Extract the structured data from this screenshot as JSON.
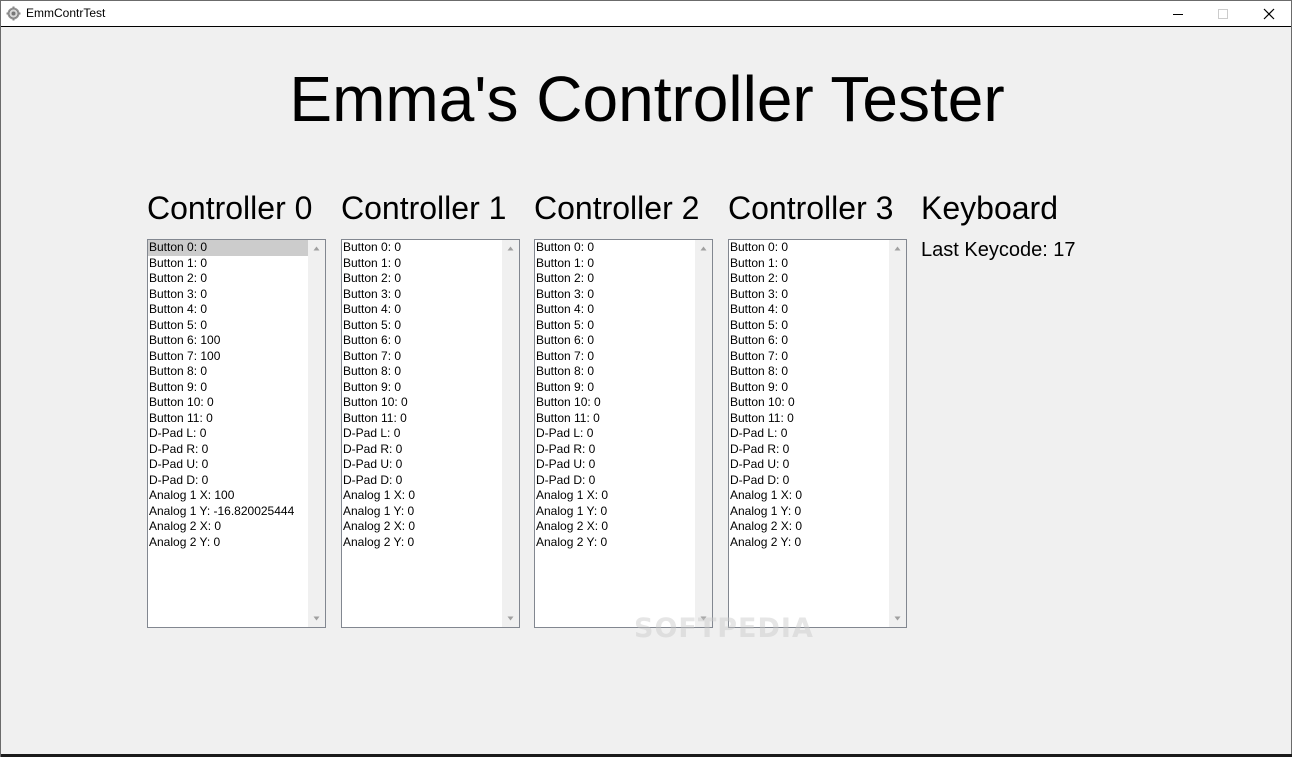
{
  "window": {
    "title": "EmmContrTest",
    "icon": "gear-icon"
  },
  "main_title": "Emma's Controller Tester",
  "controllers": [
    {
      "heading": "Controller 0",
      "selected_index": 0,
      "items": [
        "Button 0: 0",
        "Button 1: 0",
        "Button 2: 0",
        "Button 3: 0",
        "Button 4: 0",
        "Button 5: 0",
        "Button 6: 100",
        "Button 7: 100",
        "Button 8: 0",
        "Button 9: 0",
        "Button 10: 0",
        "Button 11: 0",
        "D-Pad L: 0",
        "D-Pad R: 0",
        "D-Pad U: 0",
        "D-Pad D: 0",
        "Analog 1 X: 100",
        "Analog 1 Y: -16.820025444",
        "Analog 2 X: 0",
        "Analog 2 Y: 0"
      ]
    },
    {
      "heading": "Controller 1",
      "selected_index": -1,
      "items": [
        "Button 0: 0",
        "Button 1: 0",
        "Button 2: 0",
        "Button 3: 0",
        "Button 4: 0",
        "Button 5: 0",
        "Button 6: 0",
        "Button 7: 0",
        "Button 8: 0",
        "Button 9: 0",
        "Button 10: 0",
        "Button 11: 0",
        "D-Pad L: 0",
        "D-Pad R: 0",
        "D-Pad U: 0",
        "D-Pad D: 0",
        "Analog 1 X: 0",
        "Analog 1 Y: 0",
        "Analog 2 X: 0",
        "Analog 2 Y: 0"
      ]
    },
    {
      "heading": "Controller 2",
      "selected_index": -1,
      "items": [
        "Button 0: 0",
        "Button 1: 0",
        "Button 2: 0",
        "Button 3: 0",
        "Button 4: 0",
        "Button 5: 0",
        "Button 6: 0",
        "Button 7: 0",
        "Button 8: 0",
        "Button 9: 0",
        "Button 10: 0",
        "Button 11: 0",
        "D-Pad L: 0",
        "D-Pad R: 0",
        "D-Pad U: 0",
        "D-Pad D: 0",
        "Analog 1 X: 0",
        "Analog 1 Y: 0",
        "Analog 2 X: 0",
        "Analog 2 Y: 0"
      ]
    },
    {
      "heading": "Controller 3",
      "selected_index": -1,
      "items": [
        "Button 0: 0",
        "Button 1: 0",
        "Button 2: 0",
        "Button 3: 0",
        "Button 4: 0",
        "Button 5: 0",
        "Button 6: 0",
        "Button 7: 0",
        "Button 8: 0",
        "Button 9: 0",
        "Button 10: 0",
        "Button 11: 0",
        "D-Pad L: 0",
        "D-Pad R: 0",
        "D-Pad U: 0",
        "D-Pad D: 0",
        "Analog 1 X: 0",
        "Analog 1 Y: 0",
        "Analog 2 X: 0",
        "Analog 2 Y: 0"
      ]
    }
  ],
  "keyboard": {
    "heading": "Keyboard",
    "last_keycode_label": "Last Keycode: 17"
  },
  "watermark": "SOFTPEDIA"
}
